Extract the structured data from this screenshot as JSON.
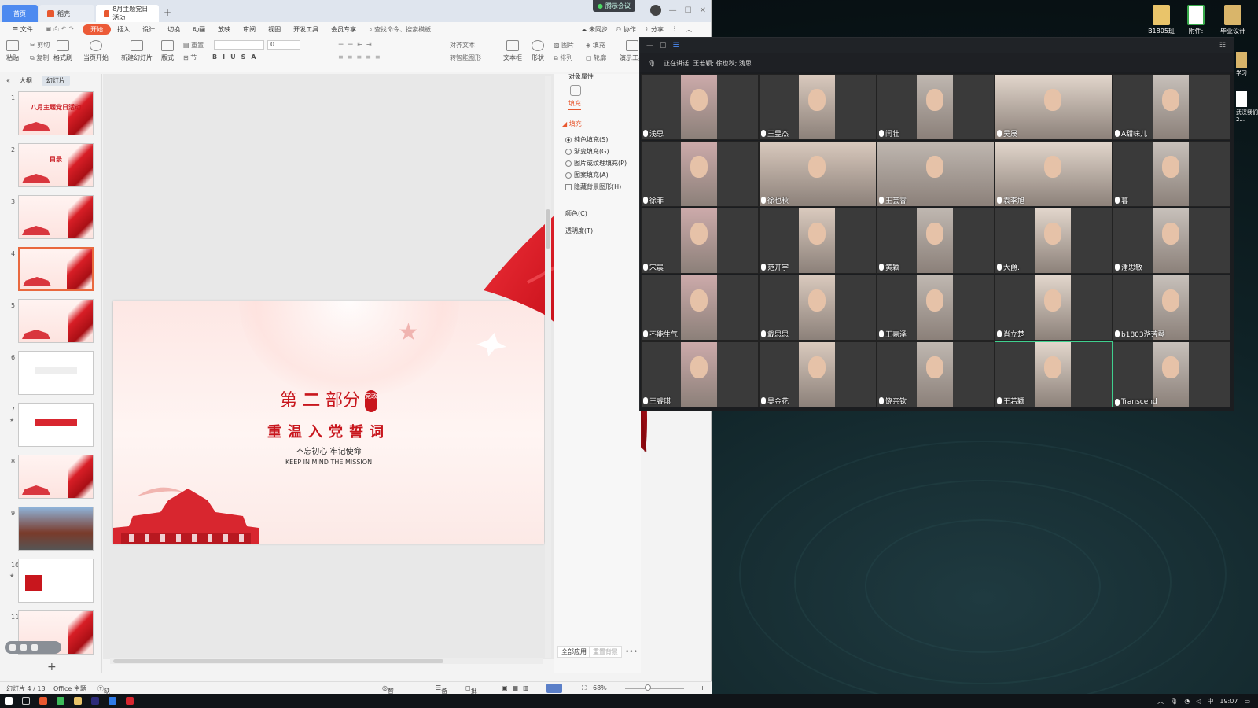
{
  "wps": {
    "tabs": [
      {
        "label": "首页"
      },
      {
        "label": "稻壳"
      },
      {
        "label": "8月主题党日活动"
      }
    ],
    "meeting_badge": "腾示会议",
    "menus": [
      "文件",
      "开始",
      "插入",
      "设计",
      "切换",
      "动画",
      "放映",
      "审阅",
      "视图",
      "开发工具",
      "会员专享"
    ],
    "search": "查找命令、搜索模板",
    "menu_right": [
      "未同步",
      "协作",
      "分享"
    ],
    "ribbon": {
      "paste": "粘贴",
      "cut": "剪切",
      "copy": "复制",
      "format_painter": "格式刷",
      "play_current": "当页开始",
      "new_slide": "新建幻灯片",
      "layout": "版式",
      "section": "节",
      "reset": "重置",
      "font_size": "0",
      "align_text": "对齐文本",
      "convert_smartart": "转智能图形",
      "textbox": "文本框",
      "shape": "形状",
      "picture": "图片",
      "fill": "填充",
      "arrange": "排列",
      "outline": "轮廓",
      "presenter": "演示工具"
    },
    "pane_tabs": [
      "大纲",
      "幻灯片"
    ],
    "thumbnails": [
      {
        "num": "1",
        "title": "八月主题党日活动"
      },
      {
        "num": "2",
        "title": "目录"
      },
      {
        "num": "3",
        "title": ""
      },
      {
        "num": "4",
        "title": ""
      },
      {
        "num": "5",
        "title": ""
      },
      {
        "num": "6",
        "title": ""
      },
      {
        "num": "7",
        "title": ""
      },
      {
        "num": "8",
        "title": ""
      },
      {
        "num": "9",
        "title": ""
      },
      {
        "num": "10",
        "title": ""
      },
      {
        "num": "11",
        "title": ""
      }
    ],
    "slide": {
      "part_prefix": "第",
      "part_num": "二",
      "part_suffix": "部分",
      "badge": "党政",
      "title": "重温入党誓词",
      "subtitle": "不忘初心 牢记使命",
      "subtitle_en": "KEEP IN MIND THE MISSION"
    },
    "props": {
      "header": "对象属性",
      "fill_tab": "填充",
      "section": "填充",
      "options": [
        "纯色填充(S)",
        "渐变填充(G)",
        "图片或纹理填充(P)",
        "图案填充(A)"
      ],
      "checkbox": "隐藏背景图形(H)",
      "color_label": "颜色(C)",
      "transparency_label": "透明度(T)",
      "apply_all": "全部应用",
      "reset_bg": "重置背景"
    },
    "status": {
      "slide_info": "幻灯片 4 / 13",
      "theme": "Office 主题",
      "missing_font": "缺失字体",
      "smart": "智能美化",
      "notes": "备注",
      "comments": "批注",
      "zoom": "68%"
    }
  },
  "meeting": {
    "speaking": "正在讲话: 王若颖; 徐也秋; 浅思...",
    "participants": [
      "浅思",
      "王昱杰",
      "闫壮",
      "吴晟",
      "A甜味儿",
      "徐菲",
      "徐也秋",
      "王芸睿",
      "袁李旭",
      "暮",
      "宋晨",
      "范开宇",
      "黄颖",
      "大爵.",
      "潘思敏",
      "不能生气",
      "戴思思",
      "王嘉泽",
      "肖立楚",
      "b1803游芳琴",
      "王睿琪",
      "吴金花",
      "饶亲钦",
      "王若颖",
      "Transcend"
    ]
  },
  "desktop": {
    "icons": [
      "B1805班",
      "附件:",
      "毕业设计"
    ],
    "side_labels": [
      "学习",
      "武汉我们2..."
    ]
  },
  "taskbar": {
    "time": "19:07",
    "ime": "中"
  }
}
